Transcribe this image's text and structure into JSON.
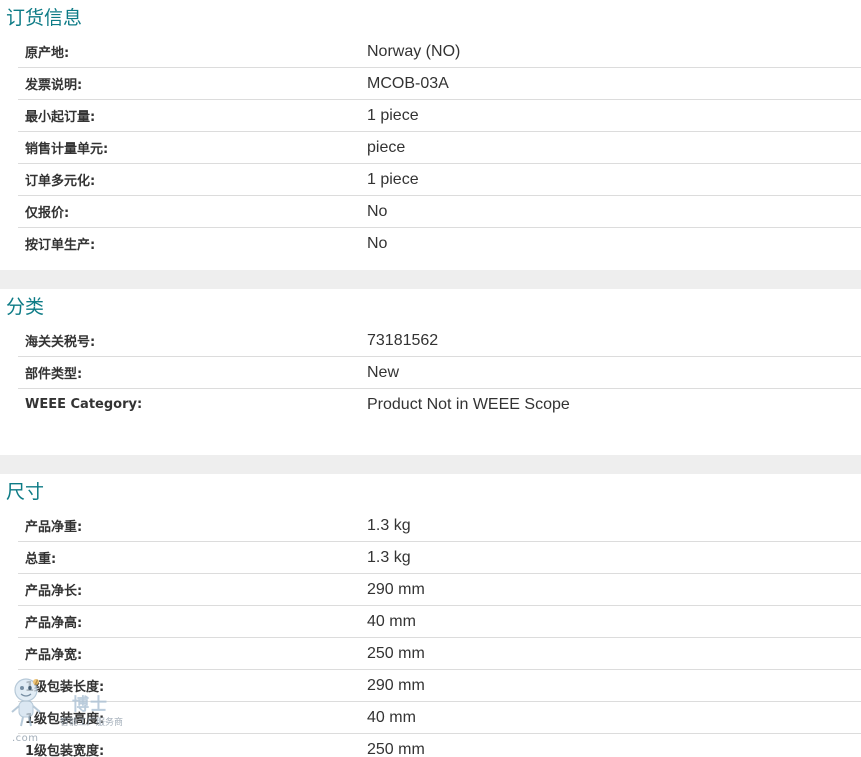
{
  "sections": [
    {
      "title": "订货信息",
      "rows": [
        {
          "label": "原产地:",
          "value": "Norway (NO)"
        },
        {
          "label": "发票说明:",
          "value": "MCOB-03A"
        },
        {
          "label": "最小起订量:",
          "value": "1 piece"
        },
        {
          "label": "销售计量单元:",
          "value": "piece"
        },
        {
          "label": "订单多元化:",
          "value": "1 piece"
        },
        {
          "label": "仅报价:",
          "value": "No"
        },
        {
          "label": "按订单生产:",
          "value": "No"
        }
      ]
    },
    {
      "title": "分类",
      "rows": [
        {
          "label": "海关关税号:",
          "value": "73181562"
        },
        {
          "label": "部件类型:",
          "value": "New"
        },
        {
          "label": "WEEE Category:",
          "value": "Product Not in WEEE Scope"
        }
      ]
    },
    {
      "title": "尺寸",
      "rows": [
        {
          "label": "产品净重:",
          "value": "1.3 kg"
        },
        {
          "label": "总重:",
          "value": "1.3 kg"
        },
        {
          "label": "产品净长:",
          "value": "290 mm"
        },
        {
          "label": "产品净高:",
          "value": "40 mm"
        },
        {
          "label": "产品净宽:",
          "value": "250 mm"
        },
        {
          "label": "1级包装长度:",
          "value": "290 mm"
        },
        {
          "label": "1级包装高度:",
          "value": "40 mm"
        },
        {
          "label": "1级包装宽度:",
          "value": "250 mm"
        }
      ]
    }
  ],
  "watermark": {
    "brand": "博士",
    "tagline": "智能工厂服务商",
    "url": ".com"
  },
  "colors": {
    "section_title": "#0d7b86",
    "text": "#333333",
    "divider": "#dcdcdc",
    "gap": "#eeeeee"
  }
}
